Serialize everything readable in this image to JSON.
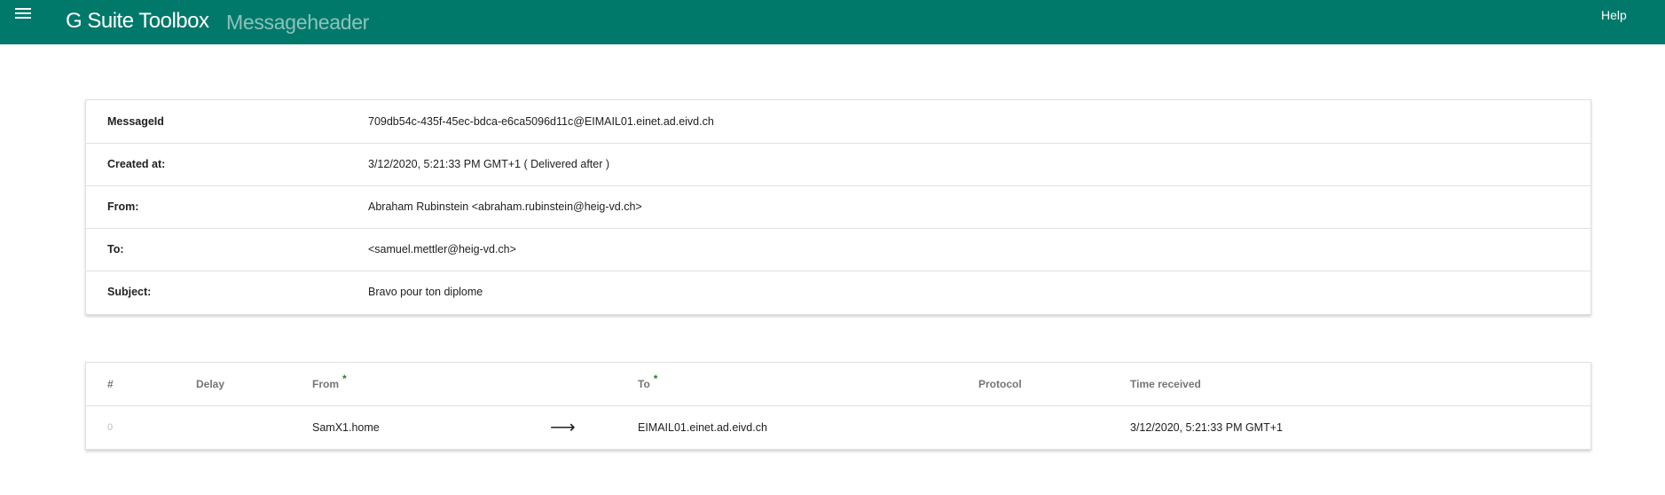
{
  "appbar": {
    "title": "G Suite Toolbox",
    "subtitle": "Messageheader",
    "help_label": "Help"
  },
  "headers": [
    {
      "key": "MessageId",
      "value": "709db54c-435f-45ec-bdca-e6ca5096d11c@EIMAIL01.einet.ad.eivd.ch"
    },
    {
      "key": "Created at:",
      "value": "3/12/2020, 5:21:33 PM GMT+1 ( Delivered after )"
    },
    {
      "key": "From:",
      "value": "Abraham Rubinstein <abraham.rubinstein@heig-vd.ch>"
    },
    {
      "key": "To:",
      "value": "<samuel.mettler@heig-vd.ch>"
    },
    {
      "key": "Subject:",
      "value": "Bravo pour ton diplome"
    }
  ],
  "hops_table": {
    "columns": {
      "index": "#",
      "delay": "Delay",
      "from": "From",
      "to": "To",
      "protocol": "Protocol",
      "time": "Time received",
      "star": "*"
    },
    "rows": [
      {
        "index": "0",
        "delay": "",
        "from": "SamX1.home",
        "arrow": "⟶",
        "to": "EIMAIL01.einet.ad.eivd.ch",
        "protocol": "",
        "time": "3/12/2020, 5:21:33 PM GMT+1"
      }
    ]
  },
  "colors": {
    "appbar": "#00796b",
    "star": "#2e7d32"
  },
  "icons": {
    "menu": "menu-icon"
  }
}
